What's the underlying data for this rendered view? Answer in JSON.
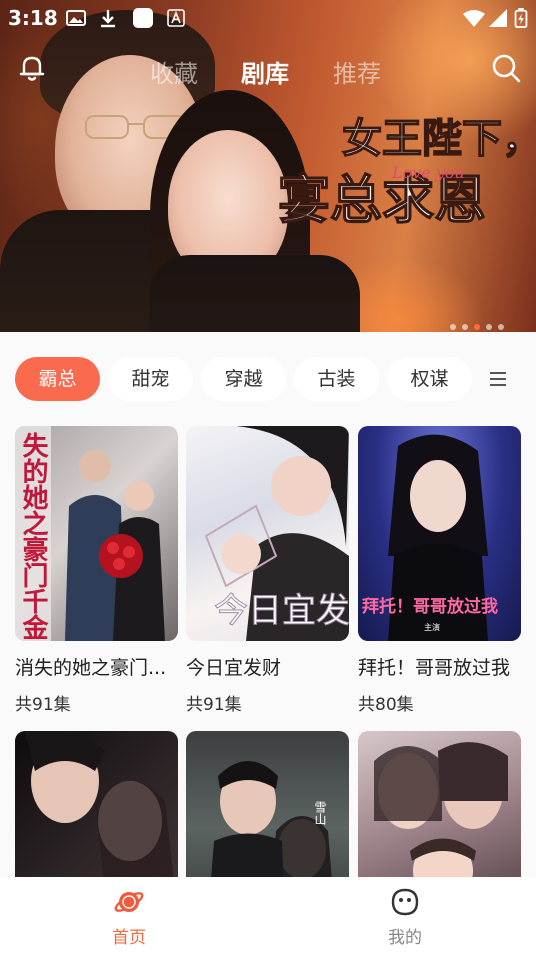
{
  "status_bar": {
    "time": "3:18"
  },
  "top_nav": {
    "tabs": [
      {
        "label": "收藏"
      },
      {
        "label": "剧库"
      },
      {
        "label": "推荐"
      }
    ],
    "active_tab": "剧库"
  },
  "banner": {
    "title_line1": "女王陛下，宠",
    "title_line2": "宴总求恩",
    "script_text": "Love you",
    "page_count": 5,
    "active_page": 3
  },
  "categories": {
    "items": [
      {
        "label": "霸总"
      },
      {
        "label": "甜宠"
      },
      {
        "label": "穿越"
      },
      {
        "label": "古装"
      },
      {
        "label": "权谋"
      }
    ],
    "active": "霸总"
  },
  "dramas": [
    {
      "title": "消失的她之豪门...",
      "episodes": "共91集",
      "poster_text": "失的她之豪门千金"
    },
    {
      "title": "今日宜发财",
      "episodes": "共91集",
      "poster_text": "今日宜发财"
    },
    {
      "title": "拜托！哥哥放过我",
      "episodes": "共80集",
      "poster_text": "拜托！哥哥放过我",
      "poster_subtext": "主演"
    },
    {
      "title": "",
      "episodes": ""
    },
    {
      "title": "",
      "episodes": "",
      "poster_text": "雪山"
    },
    {
      "title": "",
      "episodes": ""
    }
  ],
  "bottom_nav": {
    "items": [
      {
        "label": "首页"
      },
      {
        "label": "我的"
      }
    ],
    "active": "首页"
  },
  "colors": {
    "accent": "#fa6a4e",
    "nav_active": "#f26a3d",
    "nav_inactive": "#888888"
  }
}
